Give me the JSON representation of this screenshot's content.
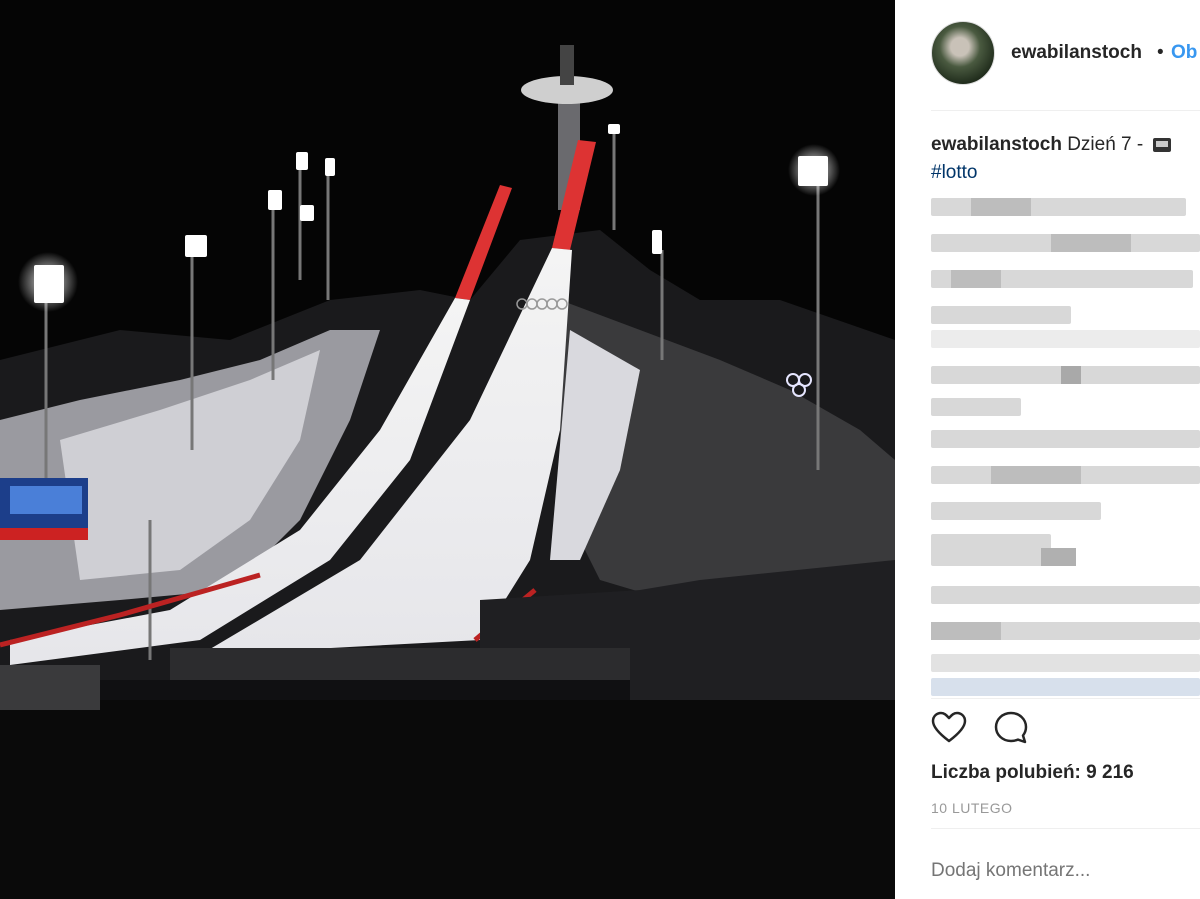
{
  "post": {
    "username": "ewabilanstoch",
    "separator": "•",
    "follow_label": "Ob",
    "caption_user": "ewabilanstoch",
    "caption_text": "Dzień 7 -",
    "hashtag": "#lotto",
    "likes": "Liczba polubień: 9 216",
    "date": "10 LUTEGO",
    "comment_placeholder": "Dodaj komentarz..."
  },
  "icons": {
    "like": "heart-icon",
    "comment": "comment-icon",
    "caption_emoji": "tv-icon"
  },
  "colors": {
    "link": "#3897f0",
    "hashtag": "#003569",
    "text": "#262626",
    "muted": "#999999"
  }
}
